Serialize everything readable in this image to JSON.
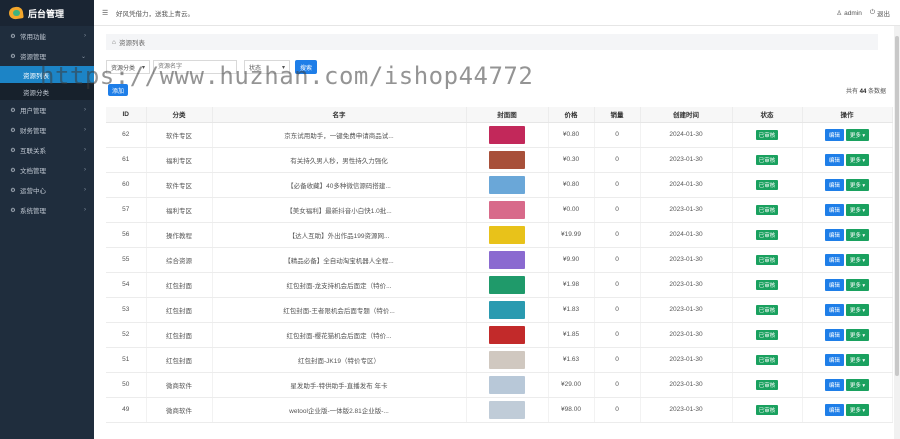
{
  "app": {
    "title": "后台管理"
  },
  "topbar": {
    "notice": "好风凭借力，送我上青云。",
    "user": "admin",
    "logout": "退出"
  },
  "sidebar": {
    "items": [
      {
        "label": "常用功能",
        "icon": "gear-icon"
      },
      {
        "label": "资源管理",
        "icon": "gear-icon",
        "expanded": true,
        "children": [
          {
            "label": "资源列表",
            "active": true
          },
          {
            "label": "资源分类",
            "active": false
          }
        ]
      },
      {
        "label": "用户管理",
        "icon": "gear-icon"
      },
      {
        "label": "财务管理",
        "icon": "gear-icon"
      },
      {
        "label": "互联关系",
        "icon": "gear-icon"
      },
      {
        "label": "文档管理",
        "icon": "gear-icon"
      },
      {
        "label": "运营中心",
        "icon": "gear-icon"
      },
      {
        "label": "系统管理",
        "icon": "gear-icon"
      }
    ]
  },
  "breadcrumb": {
    "label": "资源列表"
  },
  "filters": {
    "category_select": "资源分类",
    "name_placeholder": "资源名字",
    "status_select": "状态",
    "search_label": "搜索"
  },
  "toolbar": {
    "add_label": "添加",
    "total_prefix": "共有",
    "total_count": "44",
    "total_suffix": "条数据"
  },
  "table": {
    "headers": [
      "ID",
      "分类",
      "名字",
      "封面图",
      "价格",
      "销量",
      "创建时间",
      "状态",
      "操作"
    ],
    "rows": [
      {
        "id": "62",
        "category": "软件专区",
        "name": "京东试用助手，一键免费申请商品试...",
        "price": "¥0.80",
        "sales": "0",
        "date": "2024-01-30",
        "status": "已审核",
        "thumb": "#c2285a"
      },
      {
        "id": "61",
        "category": "福利专区",
        "name": "有关持久男人秒，男性持久力强化",
        "price": "¥0.30",
        "sales": "0",
        "date": "2023-01-30",
        "status": "已审核",
        "thumb": "#a8503a"
      },
      {
        "id": "60",
        "category": "软件专区",
        "name": "【必备收藏】40多种微信源码搭建...",
        "price": "¥0.80",
        "sales": "0",
        "date": "2024-01-30",
        "status": "已审核",
        "thumb": "#6aa7d8"
      },
      {
        "id": "57",
        "category": "福利专区",
        "name": "【美女福利】最新抖音小白快1.0批...",
        "price": "¥0.00",
        "sales": "0",
        "date": "2023-01-30",
        "status": "已审核",
        "thumb": "#d86a8a"
      },
      {
        "id": "56",
        "category": "操作教程",
        "name": "【达人互助】外出作品199资源网...",
        "price": "¥19.99",
        "sales": "0",
        "date": "2024-01-30",
        "status": "已审核",
        "thumb": "#e8c21a"
      },
      {
        "id": "55",
        "category": "综合资源",
        "name": "【精品必备】全自动淘宝机器人全程...",
        "price": "¥9.90",
        "sales": "0",
        "date": "2023-01-30",
        "status": "已审核",
        "thumb": "#8a6ad0"
      },
      {
        "id": "54",
        "category": "红包封面",
        "name": "红包封面-龙支持机会后面定（特价...",
        "price": "¥1.98",
        "sales": "0",
        "date": "2023-01-30",
        "status": "已审核",
        "thumb": "#1f9a6a"
      },
      {
        "id": "53",
        "category": "红包封面",
        "name": "红包封面-王者限机会后面专题（特价...",
        "price": "¥1.83",
        "sales": "0",
        "date": "2023-01-30",
        "status": "已审核",
        "thumb": "#2a9ab0"
      },
      {
        "id": "52",
        "category": "红包封面",
        "name": "红包封面-樱花猫机会后面定（特价...",
        "price": "¥1.85",
        "sales": "0",
        "date": "2023-01-30",
        "status": "已审核",
        "thumb": "#c22a2a"
      },
      {
        "id": "51",
        "category": "红包封面",
        "name": "红包封面-JK19（特价专区）",
        "price": "¥1.63",
        "sales": "0",
        "date": "2023-01-30",
        "status": "已审核",
        "thumb": "#d0c8c0"
      },
      {
        "id": "50",
        "category": "微商软件",
        "name": "星发助手-特供助手-直播发布 年卡",
        "price": "¥29.00",
        "sales": "0",
        "date": "2023-01-30",
        "status": "已审核",
        "thumb": "#b8c8d8"
      },
      {
        "id": "49",
        "category": "微商软件",
        "name": "wetool企业版-一体版2.81企业版-...",
        "price": "¥98.00",
        "sales": "0",
        "date": "2023-01-30",
        "status": "已审核",
        "thumb": "#c0ccd8"
      }
    ],
    "edit_label": "编辑",
    "more_label": "更多 ▾"
  },
  "watermark": "https://www.huzhan.com/ishop44772"
}
